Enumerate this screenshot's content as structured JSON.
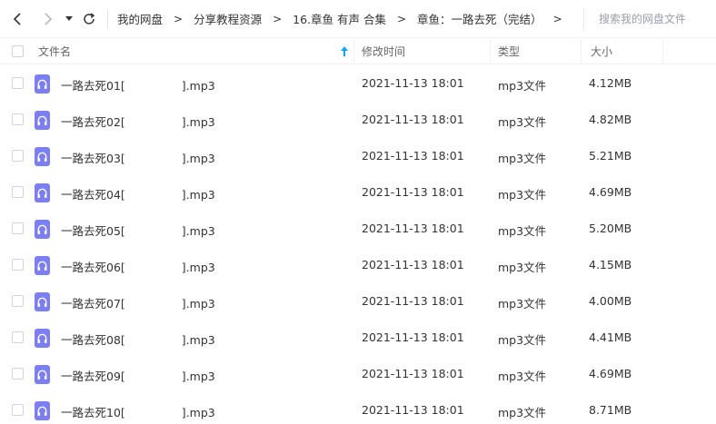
{
  "nav": {
    "back_icon": "chevron-left-icon",
    "forward_icon": "chevron-right-icon",
    "dropdown_icon": "caret-down-icon",
    "refresh_icon": "refresh-icon"
  },
  "breadcrumbs": [
    "我的网盘",
    "分享教程资源",
    "16.章鱼 有声 合集",
    "章鱼：一路去死（完结）"
  ],
  "breadcrumb_separator": ">",
  "search": {
    "placeholder": "搜索我的网盘文件"
  },
  "table": {
    "columns": {
      "name": "文件名",
      "mtime": "修改时间",
      "type": "类型",
      "size": "大小"
    },
    "sort_icon": "sort-up-arrow-icon",
    "file_icon_color": "#7b7ff0",
    "rows": [
      {
        "name_prefix": "一路去死01[",
        "name_suffix": "].mp3",
        "mtime": "2021-11-13 18:01",
        "type": "mp3文件",
        "size": "4.12MB"
      },
      {
        "name_prefix": "一路去死02[",
        "name_suffix": "].mp3",
        "mtime": "2021-11-13 18:01",
        "type": "mp3文件",
        "size": "4.82MB"
      },
      {
        "name_prefix": "一路去死03[",
        "name_suffix": "].mp3",
        "mtime": "2021-11-13 18:01",
        "type": "mp3文件",
        "size": "5.21MB"
      },
      {
        "name_prefix": "一路去死04[",
        "name_suffix": "].mp3",
        "mtime": "2021-11-13 18:01",
        "type": "mp3文件",
        "size": "4.69MB"
      },
      {
        "name_prefix": "一路去死05[",
        "name_suffix": "].mp3",
        "mtime": "2021-11-13 18:01",
        "type": "mp3文件",
        "size": "5.20MB"
      },
      {
        "name_prefix": "一路去死06[",
        "name_suffix": "].mp3",
        "mtime": "2021-11-13 18:01",
        "type": "mp3文件",
        "size": "4.15MB"
      },
      {
        "name_prefix": "一路去死07[",
        "name_suffix": "].mp3",
        "mtime": "2021-11-13 18:01",
        "type": "mp3文件",
        "size": "4.00MB"
      },
      {
        "name_prefix": "一路去死08[",
        "name_suffix": "].mp3",
        "mtime": "2021-11-13 18:01",
        "type": "mp3文件",
        "size": "4.41MB"
      },
      {
        "name_prefix": "一路去死09[",
        "name_suffix": "].mp3",
        "mtime": "2021-11-13 18:01",
        "type": "mp3文件",
        "size": "4.69MB"
      },
      {
        "name_prefix": "一路去死10[",
        "name_suffix": "].mp3",
        "mtime": "2021-11-13 18:01",
        "type": "mp3文件",
        "size": "8.71MB"
      }
    ]
  },
  "colors": {
    "sort_arrow": "#06a7ff",
    "border": "#eef0f4",
    "icon_bg": "#7b7ff0"
  }
}
